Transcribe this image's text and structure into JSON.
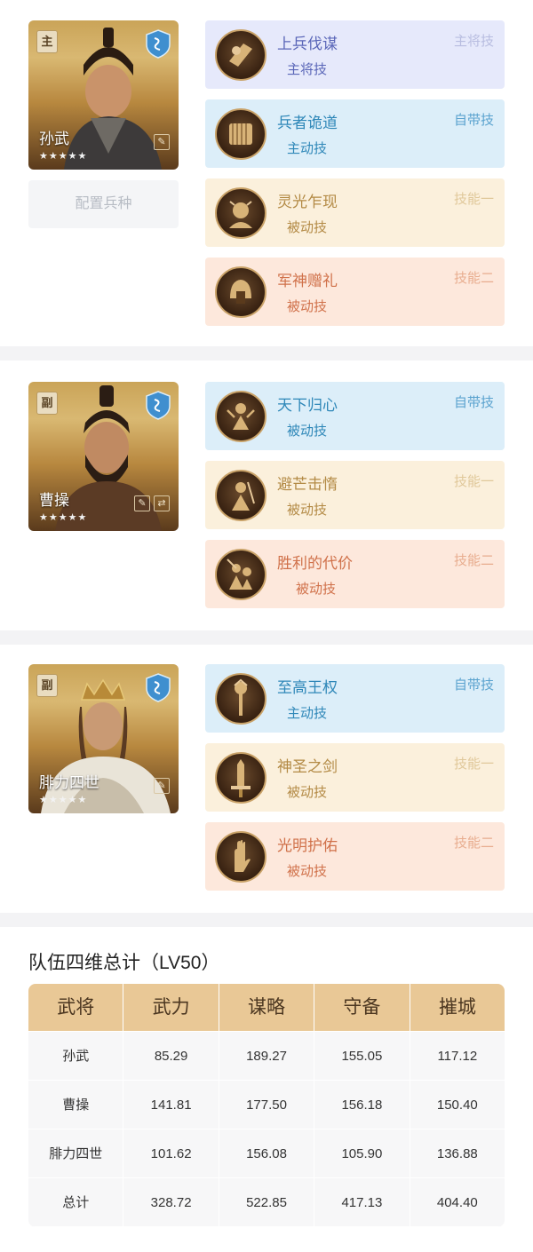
{
  "generals": [
    {
      "role": "主",
      "name": "孙武",
      "stars": "★★★★★",
      "config_label": "配置兵种",
      "skills": [
        {
          "name": "上兵伐谋",
          "type": "主将技",
          "slot": "主将技",
          "style": "purple"
        },
        {
          "name": "兵者诡道",
          "type": "主动技",
          "slot": "自带技",
          "style": "blue"
        },
        {
          "name": "灵光乍现",
          "type": "被动技",
          "slot": "技能一",
          "style": "yellow"
        },
        {
          "name": "军神赠礼",
          "type": "被动技",
          "slot": "技能二",
          "style": "orange"
        }
      ]
    },
    {
      "role": "副",
      "name": "曹操",
      "stars": "★★★★★",
      "skills": [
        {
          "name": "天下归心",
          "type": "被动技",
          "slot": "自带技",
          "style": "blue"
        },
        {
          "name": "避芒击惰",
          "type": "被动技",
          "slot": "技能一",
          "style": "yellow"
        },
        {
          "name": "胜利的代价",
          "type": "被动技",
          "slot": "技能二",
          "style": "orange"
        }
      ]
    },
    {
      "role": "副",
      "name": "腓力四世",
      "stars": "★★★★★",
      "skills": [
        {
          "name": "至高王权",
          "type": "主动技",
          "slot": "自带技",
          "style": "blue"
        },
        {
          "name": "神圣之剑",
          "type": "被动技",
          "slot": "技能一",
          "style": "yellow"
        },
        {
          "name": "光明护佑",
          "type": "被动技",
          "slot": "技能二",
          "style": "orange"
        }
      ]
    }
  ],
  "summary": {
    "title": "队伍四维总计（LV50）",
    "headers": [
      "武将",
      "武力",
      "谋略",
      "守备",
      "摧城"
    ],
    "rows": [
      [
        "孙武",
        "85.29",
        "189.27",
        "155.05",
        "117.12"
      ],
      [
        "曹操",
        "141.81",
        "177.50",
        "156.18",
        "150.40"
      ],
      [
        "腓力四世",
        "101.62",
        "156.08",
        "105.90",
        "136.88"
      ],
      [
        "总计",
        "328.72",
        "522.85",
        "417.13",
        "404.40"
      ]
    ]
  },
  "colors": {
    "header_bg": "#e9c896",
    "purple_bg": "#e6e9fb",
    "blue_bg": "#dceef9",
    "yellow_bg": "#fbf0dc",
    "orange_bg": "#fde8dc"
  },
  "icons": {
    "role_badge": "role-badge",
    "shield": "shield-icon",
    "edit": "edit-icon",
    "swap": "swap-icon"
  }
}
